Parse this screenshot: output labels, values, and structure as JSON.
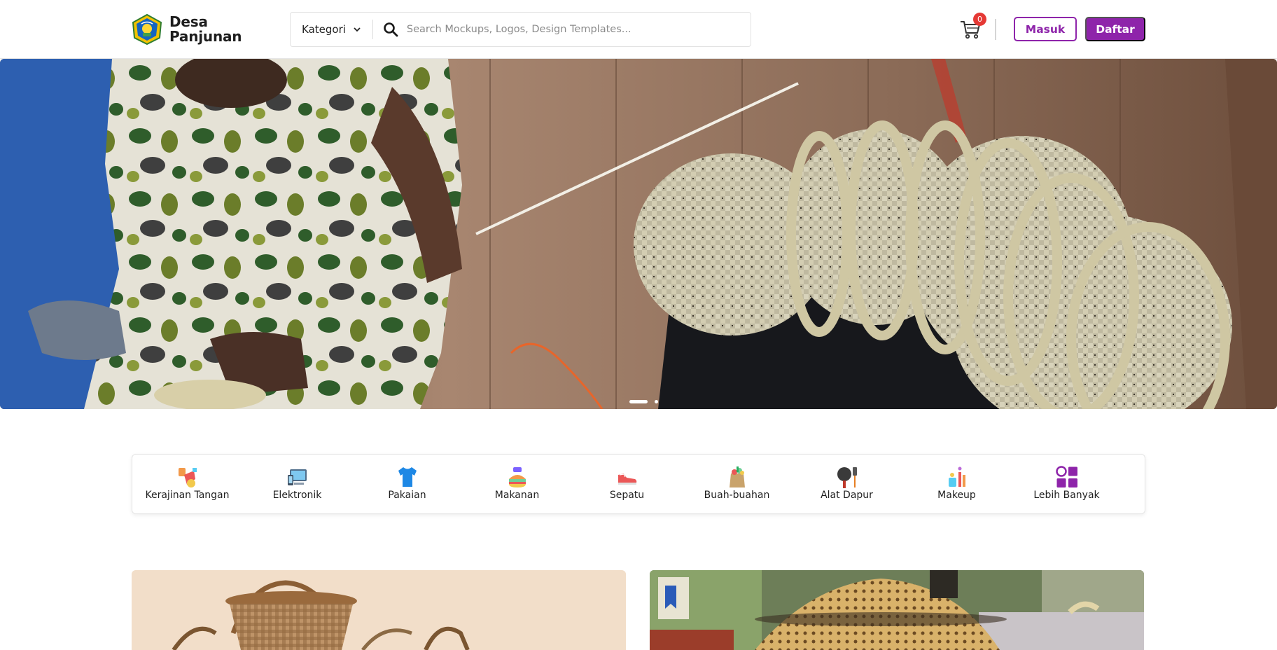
{
  "header": {
    "brand_line1": "Desa",
    "brand_line2": "Panjunan",
    "category_label": "Kategori",
    "search_placeholder": "Search Mockups, Logos, Design Templates...",
    "cart_count": "0",
    "login_label": "Masuk",
    "register_label": "Daftar"
  },
  "colors": {
    "accent": "#8e24aa",
    "badge": "#e53935"
  },
  "icons": {
    "logo": "village-emblem-icon",
    "category_dropdown": "chevron-down-icon",
    "search": "search-icon",
    "cart": "shopping-cart-icon"
  },
  "hero": {
    "slide_count": 2,
    "active_slide": 1
  },
  "categories": [
    {
      "label": "Kerajinan Tangan",
      "icon": "handicraft-icon"
    },
    {
      "label": "Elektronik",
      "icon": "electronics-icon"
    },
    {
      "label": "Pakaian",
      "icon": "tshirt-icon"
    },
    {
      "label": "Makanan",
      "icon": "food-icon"
    },
    {
      "label": "Sepatu",
      "icon": "shoe-icon"
    },
    {
      "label": "Buah-buahan",
      "icon": "fruit-bag-icon"
    },
    {
      "label": "Alat Dapur",
      "icon": "kitchen-tools-icon"
    },
    {
      "label": "Makeup",
      "icon": "makeup-icon"
    },
    {
      "label": "Lebih Banyak",
      "icon": "more-grid-icon"
    }
  ]
}
